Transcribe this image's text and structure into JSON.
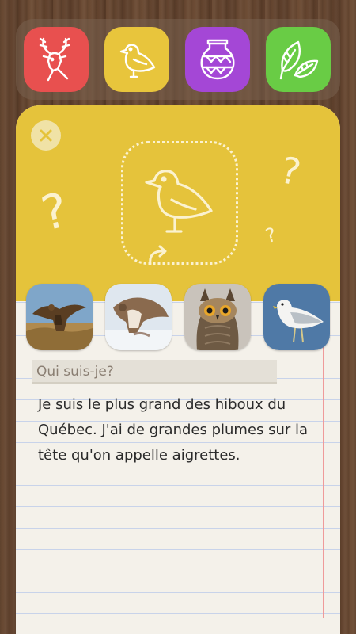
{
  "categories": [
    {
      "name": "mammals",
      "icon": "deer-icon",
      "color": "#e8504f"
    },
    {
      "name": "birds",
      "icon": "bird-icon",
      "color": "#e8c53c"
    },
    {
      "name": "artifacts",
      "icon": "pottery-icon",
      "color": "#a447d6"
    },
    {
      "name": "plants",
      "icon": "leaf-icon",
      "color": "#69cc45"
    }
  ],
  "quiz": {
    "question": "Qui suis-je?",
    "clue": "Je suis le plus grand des hiboux du Québec. J'ai de grandes plumes sur la tête qu'on appelle aigrettes."
  },
  "choices": [
    {
      "name": "eagle-photo"
    },
    {
      "name": "hawk-photo"
    },
    {
      "name": "owl-photo"
    },
    {
      "name": "gull-photo"
    }
  ],
  "colors": {
    "card_top": "#e5c33b",
    "paper": "#f4f1ea",
    "margin_line": "#ef9a9a"
  }
}
